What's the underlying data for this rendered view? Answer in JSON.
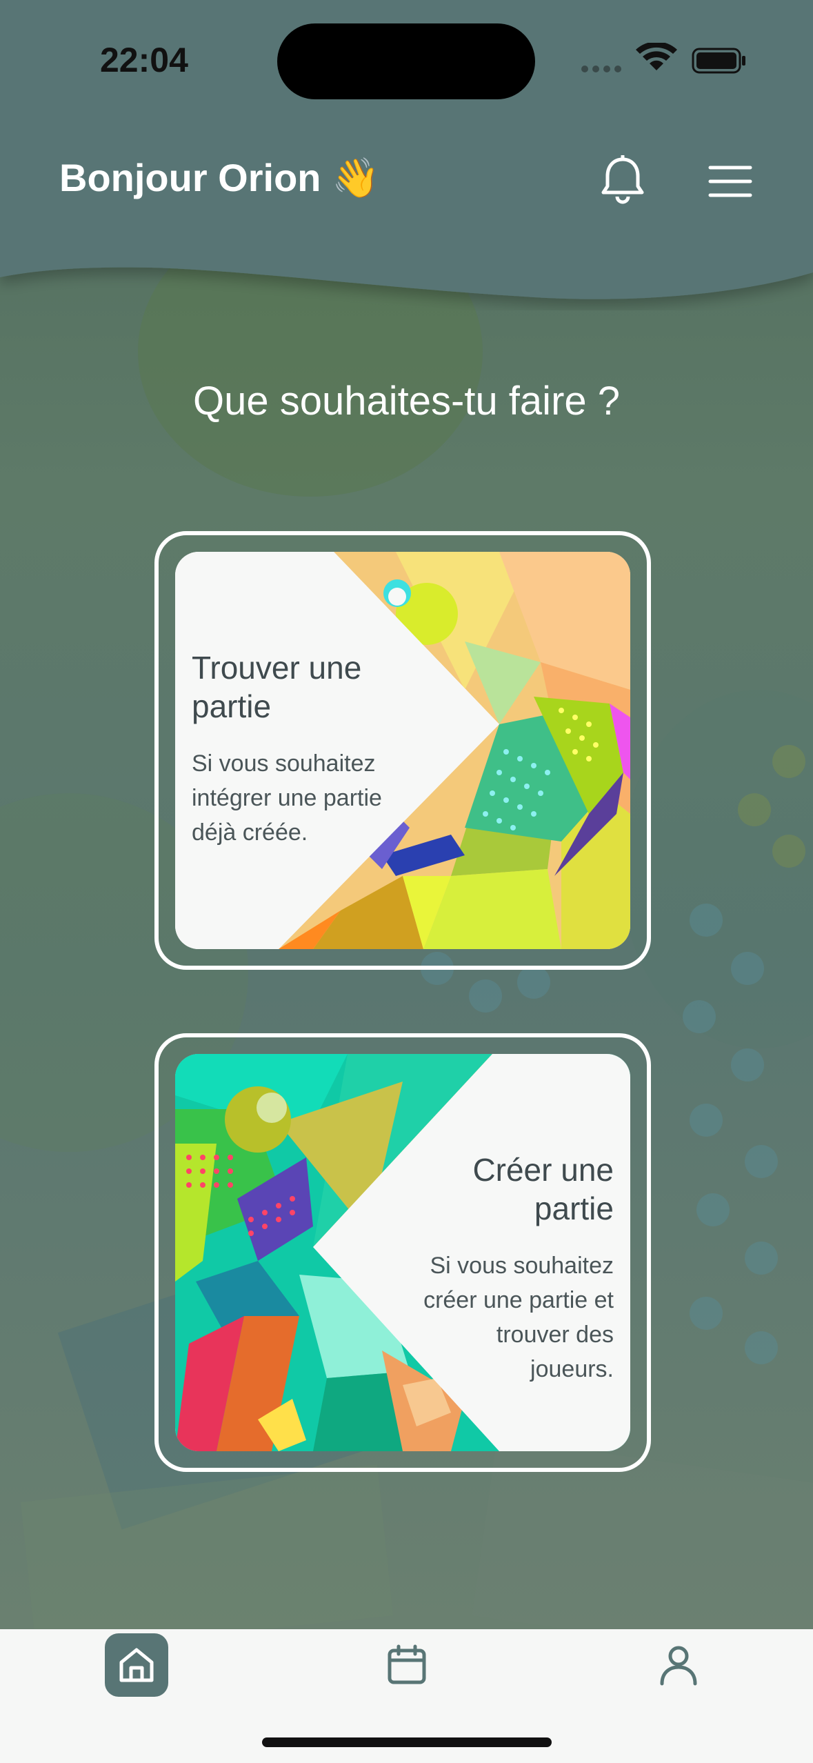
{
  "status_bar": {
    "time": "22:04"
  },
  "header": {
    "greeting": "Bonjour Orion 👋",
    "notification_icon": "bell-icon",
    "menu_icon": "hamburger-menu-icon"
  },
  "main": {
    "question": "Que souhaites-tu faire ?",
    "cards": [
      {
        "title_line1": "Trouver une",
        "title_line2": "partie",
        "desc_line1": "Si vous souhaitez",
        "desc_line2": "intégrer une partie",
        "desc_line3": "déjà créée."
      },
      {
        "title_line1": "Créer une",
        "title_line2": "partie",
        "desc_line1": "Si vous souhaitez",
        "desc_line2": "créer une partie et",
        "desc_line3": "trouver des",
        "desc_line4": "joueurs."
      }
    ]
  },
  "tabbar": {
    "tabs": [
      {
        "name": "home",
        "icon": "home-icon",
        "active": true
      },
      {
        "name": "calendar",
        "icon": "calendar-icon",
        "active": false
      },
      {
        "name": "profile",
        "icon": "user-icon",
        "active": false
      }
    ]
  },
  "colors": {
    "header_bg": "#587575",
    "active_tab_bg": "#587575",
    "accent_white": "#ffffff",
    "text_dark": "#3f4a4e"
  }
}
